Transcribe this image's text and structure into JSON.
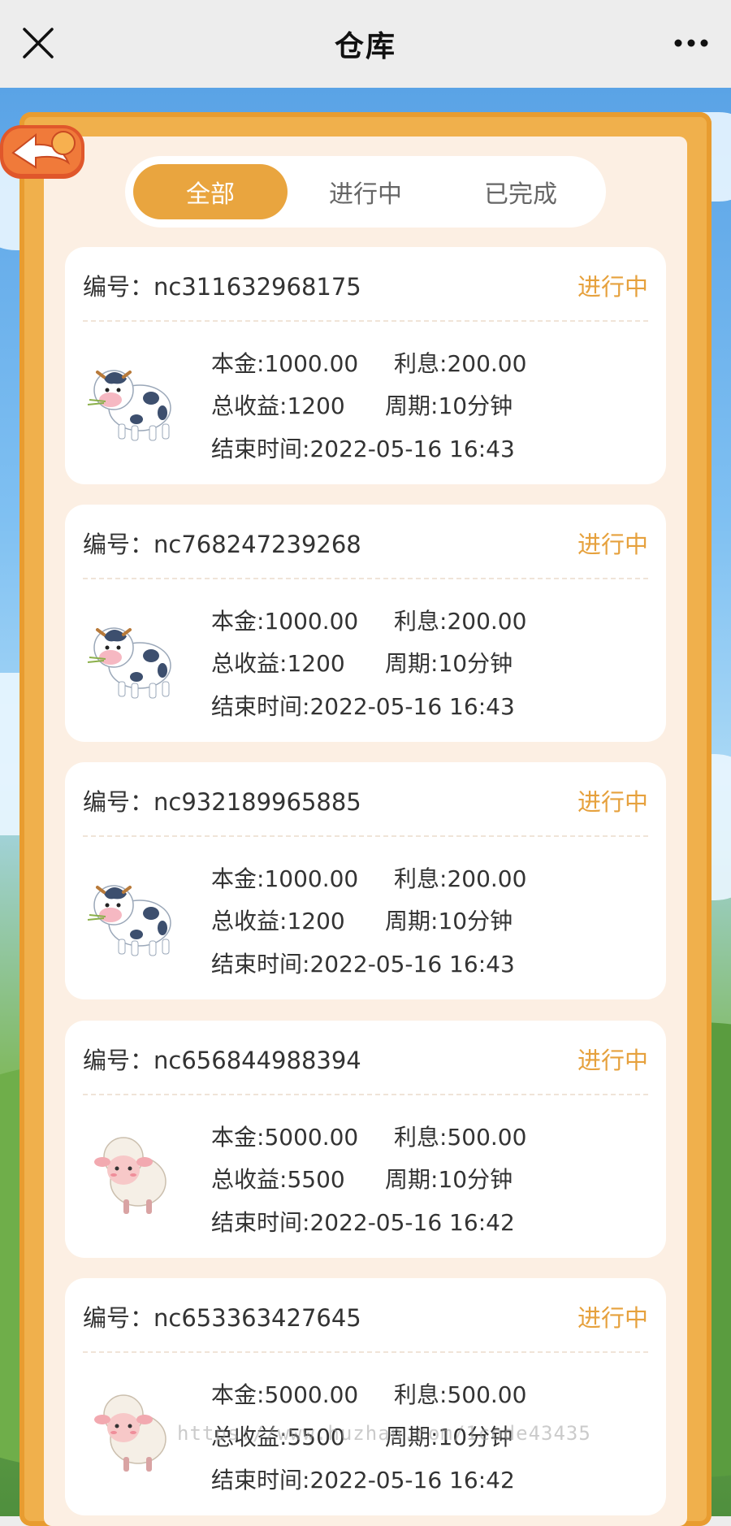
{
  "nav": {
    "title": "仓库",
    "close_icon": "close-icon",
    "more_icon": "more-icon"
  },
  "tabs": [
    {
      "label": "全部",
      "active": true
    },
    {
      "label": "进行中",
      "active": false
    },
    {
      "label": "已完成",
      "active": false
    }
  ],
  "labels": {
    "id_prefix": "编号：",
    "principal": "本金:",
    "interest": "利息:",
    "total": "总收益:",
    "period": "周期:",
    "end_time": "结束时间:"
  },
  "orders": [
    {
      "id": "nc311632968175",
      "status": "进行中",
      "animal": "cow",
      "principal": "1000.00",
      "interest": "200.00",
      "total": "1200",
      "period": "10分钟",
      "end_time": "2022-05-16 16:43"
    },
    {
      "id": "nc768247239268",
      "status": "进行中",
      "animal": "cow",
      "principal": "1000.00",
      "interest": "200.00",
      "total": "1200",
      "period": "10分钟",
      "end_time": "2022-05-16 16:43"
    },
    {
      "id": "nc932189965885",
      "status": "进行中",
      "animal": "cow",
      "principal": "1000.00",
      "interest": "200.00",
      "total": "1200",
      "period": "10分钟",
      "end_time": "2022-05-16 16:43"
    },
    {
      "id": "nc656844988394",
      "status": "进行中",
      "animal": "sheep",
      "principal": "5000.00",
      "interest": "500.00",
      "total": "5500",
      "period": "10分钟",
      "end_time": "2022-05-16 16:42"
    },
    {
      "id": "nc653363427645",
      "status": "进行中",
      "animal": "sheep",
      "principal": "5000.00",
      "interest": "500.00",
      "total": "5500",
      "period": "10分钟",
      "end_time": "2022-05-16 16:42"
    }
  ],
  "watermark": "https://www.huzhan.com/1code43435",
  "colors": {
    "accent": "#e9a53f",
    "status": "#e6a13d",
    "frame": "#f0b04c"
  }
}
